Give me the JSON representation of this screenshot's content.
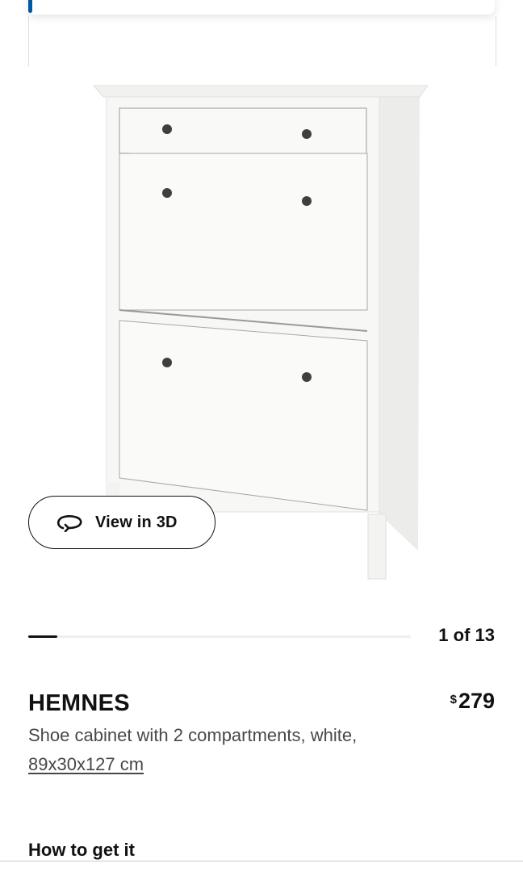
{
  "gallery": {
    "view3d_label": "View in 3D",
    "counter": "1 of 13",
    "current_index": 1,
    "total_images": 13
  },
  "product": {
    "name": "HEMNES",
    "currency": "$",
    "price": "279",
    "description": "Shoe cabinet with 2 compartments, white,",
    "dimensions": "89x30x127 cm"
  },
  "delivery": {
    "heading": "How to get it"
  },
  "colors": {
    "accent": "#0058a3",
    "text": "#111111",
    "muted_text": "#484848"
  },
  "icons": {
    "view3d": "rotate-3d-icon"
  }
}
